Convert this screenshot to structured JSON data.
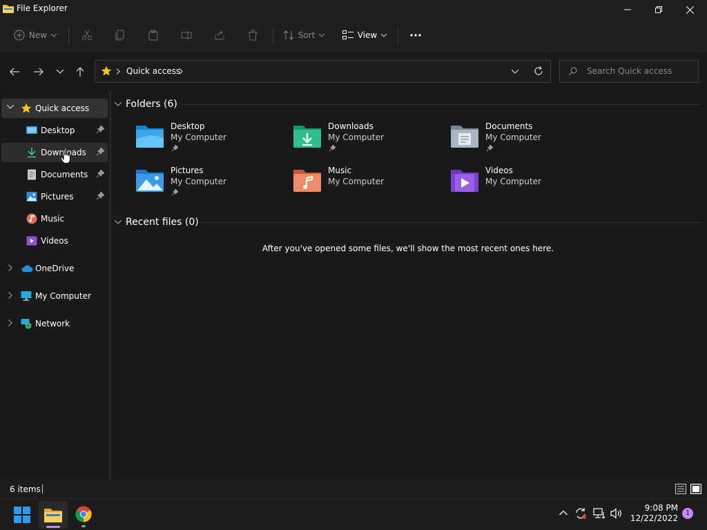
{
  "window": {
    "title": "File Explorer"
  },
  "toolbar": {
    "new_label": "New",
    "sort_label": "Sort",
    "view_label": "View"
  },
  "address": {
    "location": "Quick access",
    "search_placeholder": "Search Quick access"
  },
  "sidebar": {
    "quick_access": "Quick access",
    "items": [
      {
        "label": "Desktop",
        "pinned": true
      },
      {
        "label": "Downloads",
        "pinned": true
      },
      {
        "label": "Documents",
        "pinned": true
      },
      {
        "label": "Pictures",
        "pinned": true
      },
      {
        "label": "Music",
        "pinned": false
      },
      {
        "label": "Videos",
        "pinned": false
      }
    ],
    "roots": [
      {
        "label": "OneDrive"
      },
      {
        "label": "My Computer"
      },
      {
        "label": "Network"
      }
    ]
  },
  "main": {
    "folders_header": "Folders (6)",
    "folders": [
      {
        "name": "Desktop",
        "location": "My Computer",
        "icon": "desktop-folder-icon"
      },
      {
        "name": "Downloads",
        "location": "My Computer",
        "icon": "downloads-folder-icon"
      },
      {
        "name": "Documents",
        "location": "My Computer",
        "icon": "documents-folder-icon"
      },
      {
        "name": "Pictures",
        "location": "My Computer",
        "icon": "pictures-folder-icon"
      },
      {
        "name": "Music",
        "location": "My Computer",
        "icon": "music-folder-icon"
      },
      {
        "name": "Videos",
        "location": "My Computer",
        "icon": "videos-folder-icon"
      }
    ],
    "recent_header": "Recent files (0)",
    "recent_empty": "After you've opened some files, we'll show the most recent ones here."
  },
  "status": {
    "item_count": "6 items"
  },
  "taskbar": {
    "time": "9:08 PM",
    "date": "12/22/2022",
    "notification_count": "1"
  },
  "colors": {
    "accent": "#60cdff",
    "star": "#f5c518",
    "notification_badge": "#c58af9"
  }
}
